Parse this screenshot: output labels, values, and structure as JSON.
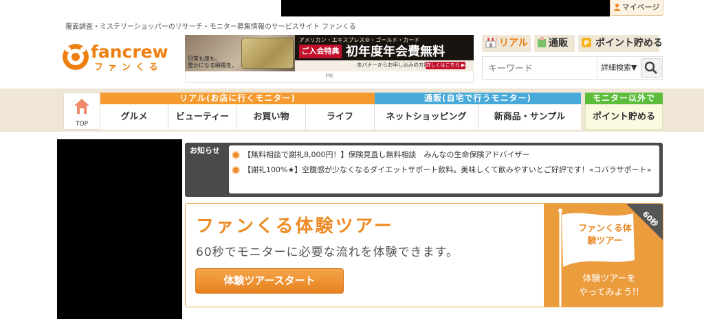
{
  "header": {
    "mypage_label": "マイページ",
    "tagline": "覆面調査・ミステリーショッパーのリサーチ・モニター募集情報のサービスサイト ファンくる",
    "logo_en": "fancrew",
    "logo_jp": "ファンくる",
    "links": {
      "real": "リアル",
      "tsuhan": "通販",
      "point": "ポイント貯める"
    },
    "search": {
      "placeholder": "キーワード",
      "option_label": "詳細検索▼",
      "button_icon": "search-icon"
    }
  },
  "banner": {
    "subtitle": "アメリカン・エキスプレス®・ゴールド・カード",
    "red_label": "ご入会特典",
    "main_text": "初年度年会費無料",
    "note": "本バナーからお申し込みの方限定",
    "button": "詳しくはこちら ▶",
    "left_text": "日常も旅も、\n豊かになる瞬間を。",
    "pr_label": "PR"
  },
  "nav": {
    "top_label": "TOP",
    "categories": {
      "real": "リアル(お店に行くモニター)",
      "tsuhan": "通販(自宅で行うモニター)",
      "other": "モニター以外で"
    },
    "items": [
      "グルメ",
      "ビューティー",
      "お買い物",
      "ライフ",
      "ネットショッピング",
      "新商品・サンプル",
      "ポイント貯める"
    ]
  },
  "notice": {
    "label": "お知らせ",
    "items": [
      "【無料相談で謝礼8,000円！】保険見直し無料相談　みんなの生命保険アドバイザー",
      "【謝礼100%★】空腹感が少なくなるダイエットサポート飲料。美味しくて飲みやすいとご好評です！«コバラサポート»"
    ]
  },
  "tour": {
    "title": "ファンくる体験ツアー",
    "description": "60秒でモニターに必要な流れを体験できます。",
    "button": "体験ツアースタート",
    "flag_text": "ファンくる体験ツアー",
    "corner_label": "60秒",
    "side_text": "体験ツアーを\nやってみよう!!"
  },
  "colors": {
    "brand_orange": "#ee8011",
    "real_category": "#f59a2e",
    "tsuhan_category": "#46a9da",
    "other_category": "#5bbd3a",
    "nav_band": "#efe6d6"
  }
}
